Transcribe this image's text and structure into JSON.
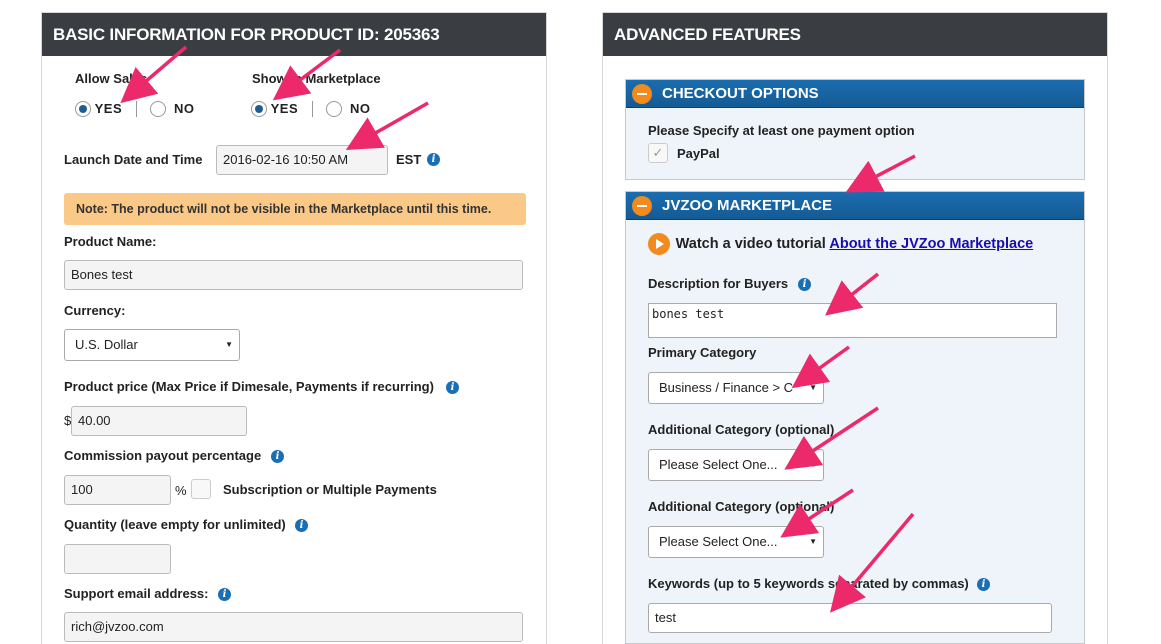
{
  "left_panel": {
    "title": "BASIC INFORMATION FOR PRODUCT ID: 205363",
    "allow_sales_label": "Allow Sales",
    "show_marketplace_label": "Show in Marketplace",
    "yes": "YES",
    "no": "NO",
    "launch_label": "Launch Date and Time",
    "launch_value": "2016-02-16 10:50 AM",
    "timezone": "EST",
    "note": "Note: The product will not be visible in the Marketplace until this time.",
    "product_name_label": "Product Name:",
    "product_name_value": "Bones test",
    "currency_label": "Currency:",
    "currency_value": "U.S. Dollar",
    "price_label": "Product price (Max Price if Dimesale, Payments if recurring)",
    "currency_symbol": "$",
    "price_value": "40.00",
    "commission_label": "Commission payout percentage",
    "commission_value": "100",
    "percent": "%",
    "subscription_label": "Subscription or Multiple Payments",
    "quantity_label": "Quantity (leave empty for unlimited)",
    "quantity_value": "",
    "support_email_label": "Support email address:",
    "support_email_value": "rich@jvzoo.com"
  },
  "right_panel": {
    "title": "ADVANCED FEATURES",
    "checkout": {
      "title": "CHECKOUT OPTIONS",
      "instruction": "Please Specify at least one payment option",
      "paypal": "PayPal"
    },
    "marketplace": {
      "title": "JVZOO MARKETPLACE",
      "video_prefix": "Watch a video tutorial",
      "video_link": "About the JVZoo Marketplace",
      "description_label": "Description for Buyers",
      "description_value": "bones test",
      "primary_category_label": "Primary Category",
      "primary_category_value": "Business / Finance > C",
      "additional_category_label_1": "Additional Category (optional)",
      "additional_category_value_1": "Please Select One...",
      "additional_category_label_2": "Additional Category (optional)",
      "additional_category_value_2": "Please Select One...",
      "keywords_label": "Keywords (up to 5 keywords separated by commas)",
      "keywords_value": "test"
    }
  },
  "icons": {
    "info": "info-icon",
    "minus": "minus-circle-icon",
    "play": "play-icon",
    "dropdown": "dropdown-arrow-icon",
    "annotation": "arrow-annotation"
  },
  "colors": {
    "header_bg": "#3a3d42",
    "sub_header_bg": "#1a6db0",
    "accent_orange": "#f28a1d",
    "note_bg": "#fbc987",
    "annotation_arrow": "#ec2a6b",
    "link": "#1a0dab"
  }
}
